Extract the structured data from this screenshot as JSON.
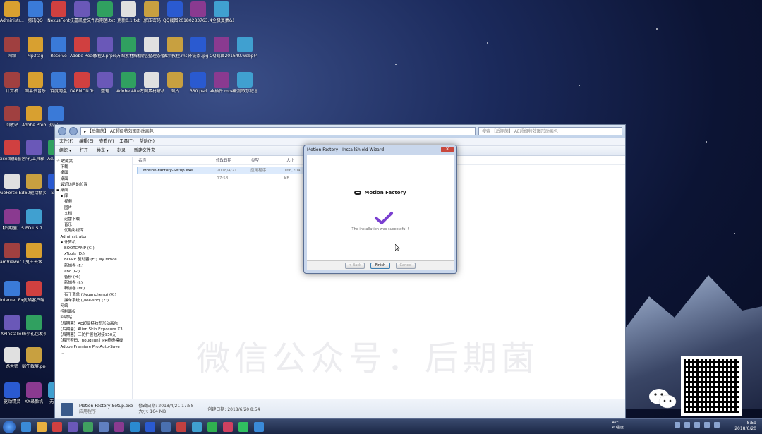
{
  "desktop": {
    "icons": [
      {
        "label": "Administr..."
      },
      {
        "label": "腾讯QQ"
      },
      {
        "label": "NexusFont"
      },
      {
        "label": "技嘉凯虚文件获取器.exe"
      },
      {
        "label": "后期菌.txt"
      },
      {
        "label": "更新0.1.txt"
      },
      {
        "label": "【解压密码：houqiju..."
      },
      {
        "label": "QQ截图20180612..."
      },
      {
        "label": "80283763..."
      },
      {
        "label": "4全极复集&发达集.xlsx"
      },
      {
        "label": "网络"
      },
      {
        "label": "Mp3tag"
      },
      {
        "label": "Resolve"
      },
      {
        "label": "Adobe Reader XI"
      },
      {
        "label": "教程2.prproj"
      },
      {
        "label": "万图素材解析器插_files"
      },
      {
        "label": "微信整理条值"
      },
      {
        "label": "演示教程.mp4"
      },
      {
        "label": "外链条.jpg"
      },
      {
        "label": "QQ截图20180619..."
      },
      {
        "label": "640.webp(4).jpg"
      },
      {
        "label": "计算机"
      },
      {
        "label": "网易云音乐"
      },
      {
        "label": "百度网盘"
      },
      {
        "label": "DAEMON Tools Lite"
      },
      {
        "label": "整理"
      },
      {
        "label": "Adobe After Effects CC..."
      },
      {
        "label": "万图素材解析器插.html"
      },
      {
        "label": "图片"
      },
      {
        "label": "330.psd"
      },
      {
        "label": "ak插件.mp4"
      },
      {
        "label": "来提取尔记总表.xlsx"
      },
      {
        "label": "回收站"
      },
      {
        "label": "Adobe Premie..."
      },
      {
        "label": "热门..."
      },
      {
        "label": "xcel编辑器客户端"
      },
      {
        "label": "小礼工具箱"
      },
      {
        "label": "Ad...Cre"
      },
      {
        "label": "GeForce Experience"
      },
      {
        "label": "360驱动精灵"
      },
      {
        "label": "Sn..."
      },
      {
        "label": "【后期菌】Skin Sm..."
      },
      {
        "label": "EDIUS 7"
      },
      {
        "label": "amViewer 12"
      },
      {
        "label": "鬼王去水"
      },
      {
        "label": "Internet Explorer"
      },
      {
        "label": "优酷客户端"
      },
      {
        "label": "XPInstaller"
      },
      {
        "label": "嗨小礼包发视频时"
      },
      {
        "label": "路大师"
      },
      {
        "label": "蜗牛截屏.png"
      },
      {
        "label": "驱动精灵"
      },
      {
        "label": "XX录像机"
      },
      {
        "label": "无标..."
      }
    ]
  },
  "explorer": {
    "address": "▸ 【后期菌】 AE超级特效图形动画包",
    "search_placeholder": "搜索 【后期菌】 AE超级特效图形动画包",
    "menu": [
      "文件(F)",
      "编辑(E)",
      "查看(V)",
      "工具(T)",
      "帮助(H)"
    ],
    "toolbar": [
      "组织 ▾",
      "打开",
      "共享 ▾",
      "刻录",
      "新建文件夹"
    ],
    "tree": [
      "☆ 收藏夹",
      "　下载",
      "　桌面",
      "　桌面",
      "　最近访问的位置",
      "",
      "▪ 桌面",
      "　▪ 库",
      "　　视频",
      "　　图片",
      "　　文档",
      "　　迅雷下载",
      "　　音乐",
      "　　优酷影视库",
      "　Administrator",
      "　▪ 计算机",
      "　　BOOTCAMP (C:)",
      "　　xTools (D:)",
      "　　BD-RE 驱动器 (E:) My Movie",
      "　　新加卷 (F:)",
      "　　abc (G:)",
      "　　备份 (H:)",
      "　　新加卷 (I:)",
      "　　新加卷 (M:)",
      "　　有子调单 (\\\\yuancheng) (X:)",
      "　　操单系统 (\\\\lee-spc) (Z:)",
      "　网络",
      "　控制面板",
      "　回收站",
      "　【后期菌】AE超级特效图形动画包",
      "　【后期菌】Alien Skin Exposure X3",
      "　【后期菌】三防扩展包对接950元",
      "　【解压密码：houqijun】PR终极模板",
      "　Adobe Premiere Pro Auto-Save",
      "　..."
    ],
    "columns": [
      "名称",
      "修改日期",
      "类型",
      "大小"
    ],
    "file": {
      "name": "Motion-Factory-Setup.exe",
      "date": "2018/4/21 17:58",
      "type": "应用程序",
      "size": "166,704 KB"
    },
    "details": {
      "name": "Motion-Factory-Setup.exe",
      "modified_label": "修改日期: 2018/4/21 17:58",
      "created_label": "创建日期: 2018/6/20 8:54",
      "type": "应用程序",
      "size": "大小: 164 MB"
    }
  },
  "dialog": {
    "title": "Motion Factory - InstallShield Wizard",
    "close": "✕",
    "brand": "Motion Factory",
    "message": "The installation was successful !",
    "buttons": {
      "back": "< Back",
      "finish": "Finish",
      "cancel": "Cancel"
    }
  },
  "watermark": "微信公众号：后期菌",
  "taskbar": {
    "temp": "47°C",
    "temp_label": "CPU温度",
    "time": "8:59",
    "date": "2018/6/20"
  },
  "colors": {
    "accent": "#7a3fd0",
    "title_bar": "#c9d7ec"
  }
}
